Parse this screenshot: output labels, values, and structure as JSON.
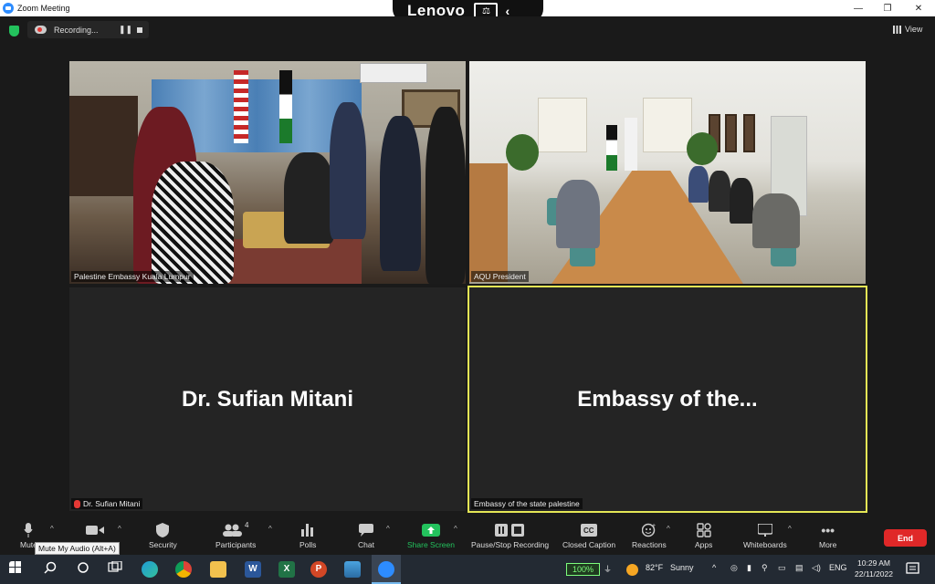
{
  "window": {
    "title": "Zoom Meeting",
    "controls": [
      "—",
      "❐",
      "✕"
    ]
  },
  "lenovo": {
    "brand": "Lenovo",
    "chevron": "‹"
  },
  "recording": {
    "label": "Recording..."
  },
  "view_button": {
    "label": "View"
  },
  "tiles": [
    {
      "label": "Palestine Embassy Kuala Lumpur"
    },
    {
      "label": "AQU President"
    },
    {
      "display_name": "Dr. Sufian Mitani",
      "label": "Dr. Sufian Mitani",
      "muted": true
    },
    {
      "display_name": "Embassy of the...",
      "label": "Embassy of the state palestine",
      "active_speaker": true
    }
  ],
  "toolbar": {
    "mute": "Mute",
    "video": "",
    "security": "Security",
    "participants": "Participants",
    "participant_count": "4",
    "polls": "Polls",
    "chat": "Chat",
    "share_screen": "Share Screen",
    "record": "Pause/Stop Recording",
    "closed_caption": "Closed Caption",
    "reactions": "Reactions",
    "apps": "Apps",
    "whiteboards": "Whiteboards",
    "more": "More",
    "end": "End",
    "tooltip": "Mute My Audio (Alt+A)"
  },
  "taskbar": {
    "battery": "100%",
    "temperature": "82°F",
    "weather": "Sunny",
    "language": "ENG",
    "time": "10:29 AM",
    "date": "22/11/2022"
  },
  "colors": {
    "accent_green": "#23c25d",
    "active_border": "#e4e655",
    "end_red": "#e02828",
    "share_green": "#23c25d"
  }
}
